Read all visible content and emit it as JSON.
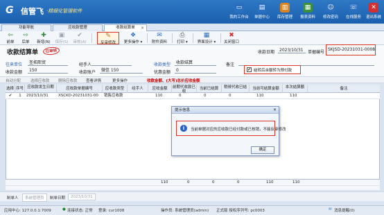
{
  "app": {
    "logo_mark": "G",
    "name": "信管飞",
    "tagline": "·精细化管理软件"
  },
  "nav": [
    {
      "label": "我的工作台",
      "icon": "monitor-icon",
      "color": "#2b6fc0"
    },
    {
      "label": "单据中心",
      "icon": "document-icon",
      "color": "#2b6fc0"
    },
    {
      "label": "库存管理",
      "icon": "warehouse-icon",
      "color": "#d9841f"
    },
    {
      "label": "报表资料",
      "icon": "chart-icon",
      "color": "#3b8f3b"
    },
    {
      "label": "修改密码",
      "icon": "person-icon",
      "color": "#2b6fc0"
    },
    {
      "label": "在线服务",
      "icon": "service-icon",
      "color": "#2b6fc0"
    },
    {
      "label": "退出系统",
      "icon": "close-icon",
      "color": "#d23030"
    }
  ],
  "tabs": [
    {
      "label": "功能导航"
    },
    {
      "label": "应收款管理"
    },
    {
      "label": "收款结算单"
    }
  ],
  "toolbar": [
    {
      "label": "前单",
      "icon": "arrow-left-icon",
      "glyph": "⇦"
    },
    {
      "label": "后单",
      "icon": "arrow-right-icon",
      "glyph": "⇨"
    },
    {
      "label": "新增(N)",
      "icon": "add-icon",
      "glyph": "✚"
    },
    {
      "label": "保存(S)",
      "icon": "save-icon",
      "glyph": "▣"
    },
    {
      "label": "审核(A)",
      "icon": "audit-icon",
      "glyph": "✔"
    },
    {
      "label": "反审修改",
      "icon": "unaudit-edit-icon",
      "glyph": "✎"
    },
    {
      "label": "更多操作 ▾",
      "icon": "more-icon",
      "glyph": "❖"
    },
    {
      "label": "附件资料",
      "icon": "attachment-icon",
      "glyph": "✉"
    },
    {
      "label": "打印 ▾",
      "icon": "print-icon",
      "glyph": "⎙"
    },
    {
      "label": "界面设计 ▾",
      "icon": "design-icon",
      "glyph": "▦"
    },
    {
      "label": "关闭窗口",
      "icon": "close-window-icon",
      "glyph": "✖"
    }
  ],
  "form": {
    "title": "收款结算单",
    "stamp": "已审核",
    "date_label": "收款日期",
    "date_value": "2023/10/31",
    "number_label": "单据编号",
    "number_value": "SKJSD-20231031-0008",
    "customer_label": "往来单位",
    "customer_value": "圣拓熙贸",
    "handler_label": "经手人",
    "handler_value": "",
    "type_label": "收款类型",
    "type_value": "收款结算",
    "note_label": "备注",
    "note_value": "",
    "amount_label": "收款金额",
    "amount_value": "150",
    "account_label": "收款账户",
    "account_value": "微信 150",
    "discount_label": "优惠金额",
    "discount_value": "0",
    "checkbox_label": "结转后余额转为预付款",
    "checkbox_checked": true
  },
  "grid_toolbar": {
    "auto_split": "自动分配",
    "select_doc": "选择应收款",
    "delete_row": "删除应收款",
    "view_detail": "查看详情",
    "more_ops": "更多操作",
    "amount_hint": "收款金额、(大写)总价应收金额"
  },
  "grid": {
    "columns": [
      "选择",
      "序号",
      "应收款发生日期",
      "应收款单据编号",
      "应收款类型",
      "经手人",
      "应收金额",
      "前期代收款已收",
      "当前已结算",
      "稍候代收已结",
      "当前可结算金额",
      "本次结算额",
      "备注"
    ],
    "rows": [
      {
        "check": "✔",
        "seq": "1",
        "date": "2023/10/31",
        "number": "XSCKD-20231031-00",
        "type": "销售应收款",
        "handler": "",
        "amount": "110",
        "prev": "0",
        "settled": "0",
        "wait": "0",
        "available": "110",
        "this": "110",
        "note": ""
      }
    ],
    "totals": {
      "amount": "110",
      "prev": "0",
      "settled": "0",
      "wait": "0",
      "available": "110",
      "this": "110"
    }
  },
  "bottom": {
    "creator_label": "制单人",
    "creator_value": "系统管理员",
    "created_label": "制单日期",
    "created_value": "2023/10/31"
  },
  "dialog": {
    "title": "提示信息",
    "icon": "info-icon",
    "message": "当前单据对应的应收款已经付款或已核销，不能反审修改",
    "ok_label": "确定"
  },
  "status": {
    "server": "应用中心: 127.0.0.1:7009",
    "connection": "连接状态: 正常",
    "user": "登录: cur1008",
    "operator": "操作员: 系统管理员(admin)",
    "version": "正式版  授权序列号: pc0003",
    "message_label": "消息提醒(0)"
  }
}
